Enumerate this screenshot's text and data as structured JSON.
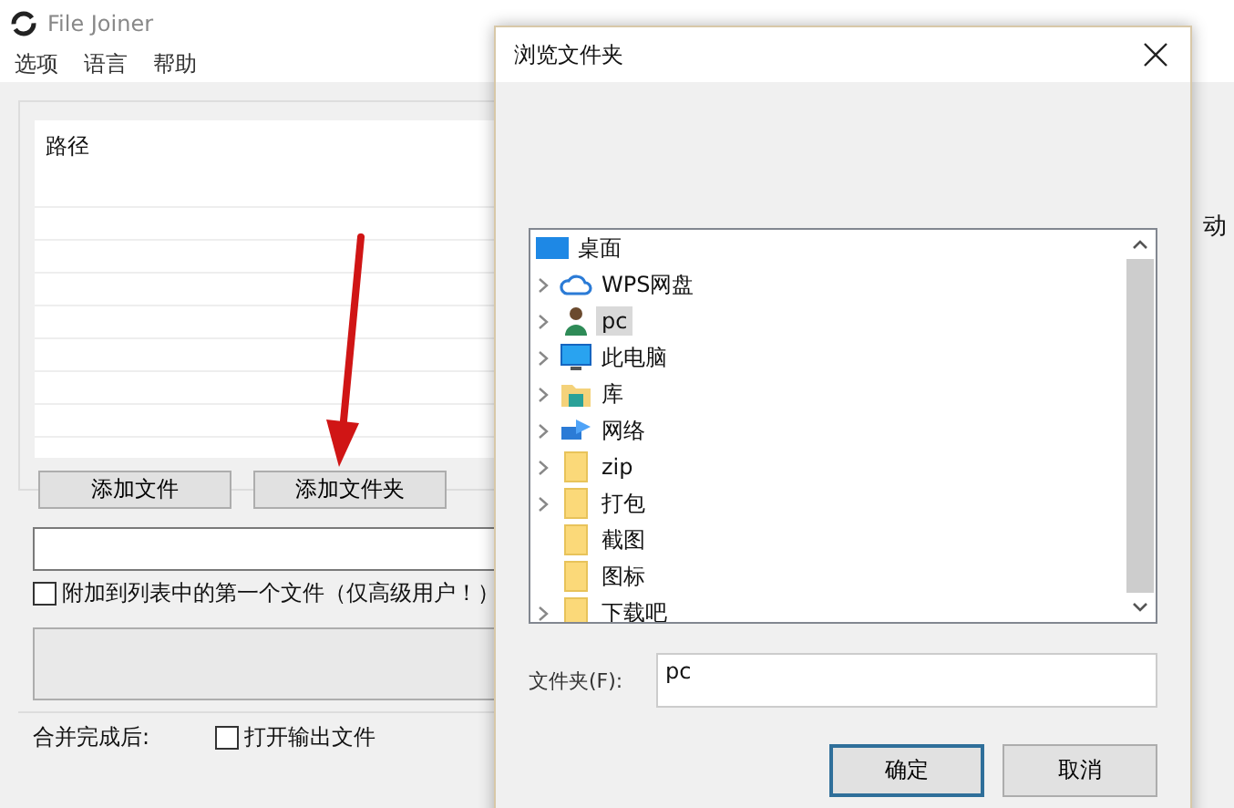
{
  "window": {
    "title": "File Joiner"
  },
  "menu": [
    "选项",
    "语言",
    "帮助"
  ],
  "file_list": {
    "column": "路径"
  },
  "list_buttons": [
    "添加文件",
    "添加文件夹"
  ],
  "append_option": {
    "label": "附加到列表中的第一个文件（仅高级用户！）",
    "checked": false
  },
  "after_merge": {
    "label": "合并完成后:",
    "open_output": {
      "label": "打开输出文件",
      "checked": false
    }
  },
  "side_label": "动",
  "dialog": {
    "title": "浏览文件夹",
    "tree": [
      {
        "label": "桌面",
        "kind": "desktop",
        "selected": false,
        "children": [
          {
            "label": "WPS网盘",
            "kind": "cloud",
            "expandable": true,
            "selected": false
          },
          {
            "label": "pc",
            "kind": "user",
            "expandable": true,
            "selected": true
          },
          {
            "label": "此电脑",
            "kind": "monitor",
            "expandable": true,
            "selected": false
          },
          {
            "label": "库",
            "kind": "library",
            "expandable": true,
            "selected": false
          },
          {
            "label": "网络",
            "kind": "network",
            "expandable": true,
            "selected": false
          },
          {
            "label": "zip",
            "kind": "folder",
            "expandable": true,
            "selected": false
          },
          {
            "label": "打包",
            "kind": "folder",
            "expandable": true,
            "selected": false
          },
          {
            "label": "截图",
            "kind": "folder",
            "expandable": false,
            "selected": false
          },
          {
            "label": "图标",
            "kind": "folder",
            "expandable": false,
            "selected": false
          },
          {
            "label": "下载吧",
            "kind": "folder",
            "expandable": true,
            "selected": false
          }
        ]
      }
    ],
    "folder_field": {
      "label": "文件夹(F):",
      "value": "pc"
    },
    "buttons": [
      {
        "label": "确定",
        "default": true
      },
      {
        "label": "取消",
        "default": false
      }
    ]
  }
}
